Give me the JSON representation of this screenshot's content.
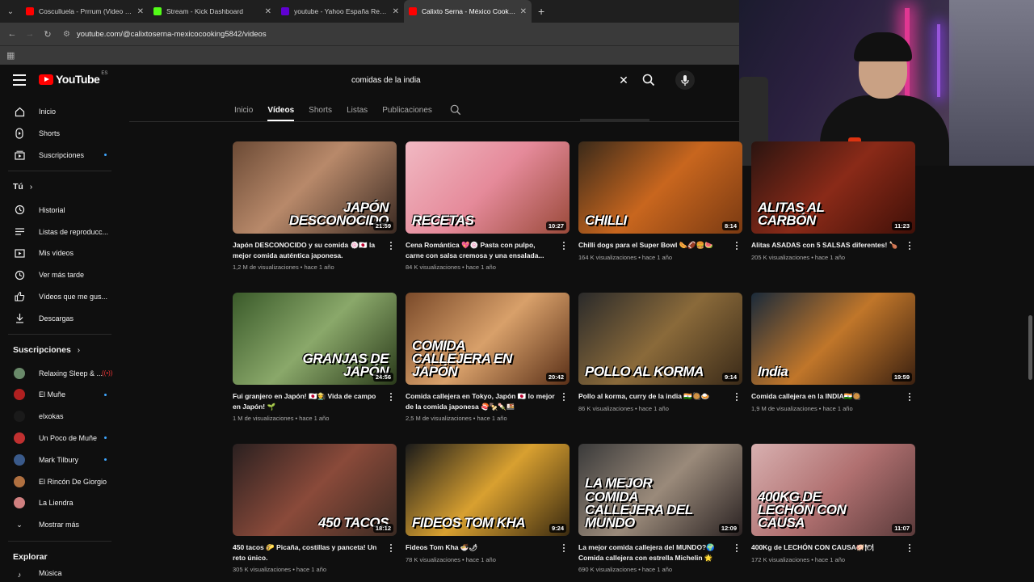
{
  "browser": {
    "tabs": [
      {
        "title": "Cosculluela - Prrrum (Video Of...",
        "favicon_color": "#ff0000"
      },
      {
        "title": "Stream - Kick Dashboard",
        "favicon_color": "#53fc18"
      },
      {
        "title": "youtube - Yahoo España Result...",
        "favicon_color": "#6001d2"
      },
      {
        "title": "Calixto Serna - México Cooking...",
        "favicon_color": "#ff0000"
      }
    ],
    "url": "youtube.com/@calixtoserna-mexicocooking5842/videos"
  },
  "youtube": {
    "logo_text": "YouTube",
    "country_code": "ES",
    "search_query": "comidas de la india"
  },
  "sidebar": {
    "main": [
      {
        "label": "Inicio",
        "icon": "home-icon"
      },
      {
        "label": "Shorts",
        "icon": "shorts-icon"
      },
      {
        "label": "Suscripciones",
        "icon": "subscriptions-icon",
        "dot": true
      }
    ],
    "you_heading": "Tú",
    "you": [
      {
        "label": "Historial",
        "icon": "history-icon"
      },
      {
        "label": "Listas de reproducc...",
        "icon": "playlists-icon"
      },
      {
        "label": "Mis vídeos",
        "icon": "my-videos-icon"
      },
      {
        "label": "Ver más tarde",
        "icon": "watch-later-icon"
      },
      {
        "label": "Vídeos que me gus...",
        "icon": "liked-icon"
      },
      {
        "label": "Descargas",
        "icon": "download-icon"
      }
    ],
    "subs_heading": "Suscripciones",
    "subs": [
      {
        "label": "Relaxing Sleep & ...",
        "color": "#6a8a6a",
        "live": true
      },
      {
        "label": "El Muñe",
        "color": "#b02020",
        "dot": true
      },
      {
        "label": "elxokas",
        "color": "#1a1a1a",
        "dot": false
      },
      {
        "label": "Un Poco de Muñe",
        "color": "#c03030",
        "dot": true
      },
      {
        "label": "Mark Tilbury",
        "color": "#3a5a8a",
        "dot": true
      },
      {
        "label": "El Rincón De Giorgio",
        "color": "#b07040",
        "dot": false
      },
      {
        "label": "La Liendra",
        "color": "#d08080",
        "dot": false
      }
    ],
    "show_more": "Mostrar más",
    "explore_heading": "Explorar",
    "explore_first": "Música"
  },
  "channel_tabs": [
    "Inicio",
    "Vídeos",
    "Shorts",
    "Listas",
    "Publicaciones"
  ],
  "active_tab": "Vídeos",
  "videos": [
    {
      "title": "Japón DESCONOCIDO y su comida 🍥🇯🇵 la mejor comida auténtica japonesa.",
      "meta": "1,2 M de visualizaciones • hace 1 año",
      "duration": "21:59",
      "overlay": "JAPÓN DESCONOCIDO",
      "bg": "linear-gradient(135deg,#6b4a35,#b8896a 45%,#3b2a22)"
    },
    {
      "title": "Cena Romántica 💖🍥 Pasta con pulpo, carne con salsa cremosa y una ensalada...",
      "meta": "84 K visualizaciones • hace 1 año",
      "duration": "10:27",
      "overlay": "RECETAS",
      "bg": "linear-gradient(135deg,#f1b9c3,#e58a9a 50%,#9a4a3a)"
    },
    {
      "title": "Chilli dogs para el Super Bowl 🌭🏈🍔🍉",
      "meta": "164 K visualizaciones • hace 1 año",
      "duration": "8:14",
      "overlay": "CHILLI",
      "bg": "linear-gradient(135deg,#3a2a1a,#c8661e 50%,#7a3a12)"
    },
    {
      "title": "Alitas ASADAS con 5 SALSAS diferentes! 🍗",
      "meta": "205 K visualizaciones • hace 1 año",
      "duration": "11:23",
      "overlay": "ALITAS AL CARBÓN",
      "bg": "linear-gradient(135deg,#2a1410,#8a2a18 50%,#401008)"
    },
    {
      "title": "Fui granjero en Japón! 🇯🇵👨‍🌾 Vida de campo en Japón! 🌱",
      "meta": "1 M de visualizaciones • hace 1 año",
      "duration": "24:56",
      "overlay": "GRANJAS DE JAPÓN",
      "bg": "linear-gradient(135deg,#3a5a2a,#8aa86a 50%,#2a3a1a)"
    },
    {
      "title": "Comida callejera en Tokyo, Japón 🇯🇵 lo mejor de la comida japonesa 🍣🍢🍡🍱",
      "meta": "2,5 M de visualizaciones • hace 1 año",
      "duration": "20:42",
      "overlay": "COMIDA CALLEJERA EN JAPÓN",
      "bg": "linear-gradient(135deg,#7a4a2a,#d8a06a 50%,#5a3018)"
    },
    {
      "title": "Pollo al korma, curry de la india 🇮🇳🥘🍛",
      "meta": "86 K visualizaciones • hace 1 año",
      "duration": "9:14",
      "overlay": "POLLO AL KORMA",
      "bg": "linear-gradient(135deg,#2a2a2a,#8a6a3a 50%,#3a2a18)"
    },
    {
      "title": "Comida callejera en la INDIA🇮🇳🥘",
      "meta": "1,9 M de visualizaciones • hace 1 año",
      "duration": "19:59",
      "overlay": "India",
      "bg": "linear-gradient(135deg,#1a2a3a,#c0762a 50%,#3a2010)"
    },
    {
      "title": "450 tacos 🌮 Picaña, costillas y panceta! Un reto único.",
      "meta": "305 K visualizaciones • hace 1 año",
      "duration": "18:12",
      "overlay": "450 TACOS",
      "bg": "linear-gradient(135deg,#2a2020,#8a4a3a 50%,#3a2a22)"
    },
    {
      "title": "Fideos Tom Kha 🍜🌶",
      "meta": "78 K visualizaciones • hace 1 año",
      "duration": "9:24",
      "overlay": "FIDEOS TOM KHA",
      "bg": "linear-gradient(135deg,#1a1a1a,#d8a030 50%,#3a2a10)"
    },
    {
      "title": "La mejor comida callejera del MUNDO?🌍 Comida callejera con estrella Michelin 🌟",
      "meta": "690 K visualizaciones • hace 1 año",
      "duration": "12:09",
      "overlay": "LA MEJOR COMIDA CALLEJERA DEL MUNDO",
      "bg": "linear-gradient(135deg,#3a3a3a,#9a8a7a 50%,#2a2222)"
    },
    {
      "title": "400Kg de LECHÓN CON CAUSA🐖🍽",
      "meta": "172 K visualizaciones • hace 1 año",
      "duration": "11:07",
      "overlay": "400KG DE LECHÓN CON CAUSA",
      "bg": "linear-gradient(135deg,#d8b0b0,#b07070 50%,#5a3a3a)"
    }
  ]
}
